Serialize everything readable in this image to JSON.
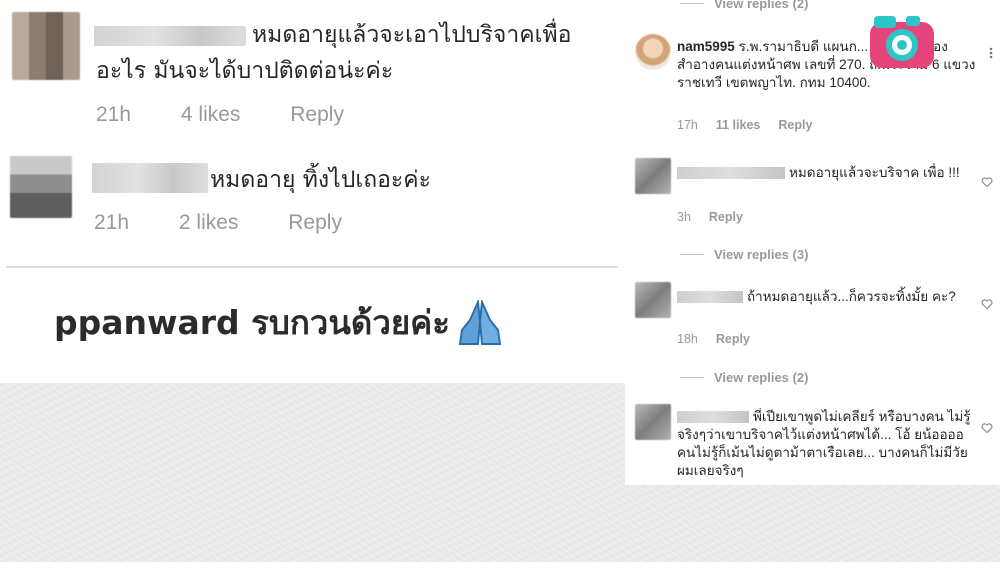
{
  "left": {
    "comments": [
      {
        "text_line1": "หมดอายุแล้วจะเอาไปบริจาคเพื่อ",
        "text_line2": "อะไร มันจะได้บาปติดต่อน่ะค่ะ",
        "time": "21h",
        "likes": "4 likes",
        "reply": "Reply"
      },
      {
        "text_line1": "หมดอายุ ทิ้งไปเถอะค่ะ",
        "time": "21h",
        "likes": "2 likes",
        "reply": "Reply"
      }
    ],
    "caption": "ppanward รบกวนด้วยค่ะ"
  },
  "right": {
    "top_view_replies": "View replies (2)",
    "comments": [
      {
        "username": "nam5995",
        "text": "ร.พ.รามาธิบดี แผนก... บริจาคเครื่องสำอางคนแต่งหน้าศพ เลขที่ 270. ถ.พระราม 6 แขวงราชเทวี เขตพญาไท. กทม 10400.",
        "time": "17h",
        "likes": "11 likes",
        "reply": "Reply"
      },
      {
        "text": "หมดอายุแล้วจะบริจาค เพื่อ !!!",
        "time": "3h",
        "reply": "Reply",
        "view_replies": "View replies (3)"
      },
      {
        "text": "ถ้าหมดอายุแล้ว...ก็ควรจะทิ้งมั้ย คะ?",
        "time": "18h",
        "reply": "Reply",
        "view_replies": "View replies (2)"
      },
      {
        "text": "พี่เปียเขาพูดไม่เคลียร์ หรือบางคน ไม่รู้จริงๆว่าเขาบริจาคไว้แต่งหน้าศพได้... โอ้ ยน้ออออ คนไม่รู้ก็เม้นไม่ดูตาม้าตาเรือเลย... บางคนก็ไม่มีวัยผมเลยจริงๆ"
      }
    ]
  },
  "icons": {
    "logo": "camera-logo-icon",
    "heart": "heart-icon",
    "pray": "folded-hands-emoji"
  },
  "colors": {
    "text": "#262626",
    "meta": "#999999",
    "logo_pink": "#e5457a",
    "logo_teal": "#2cc6c9"
  }
}
